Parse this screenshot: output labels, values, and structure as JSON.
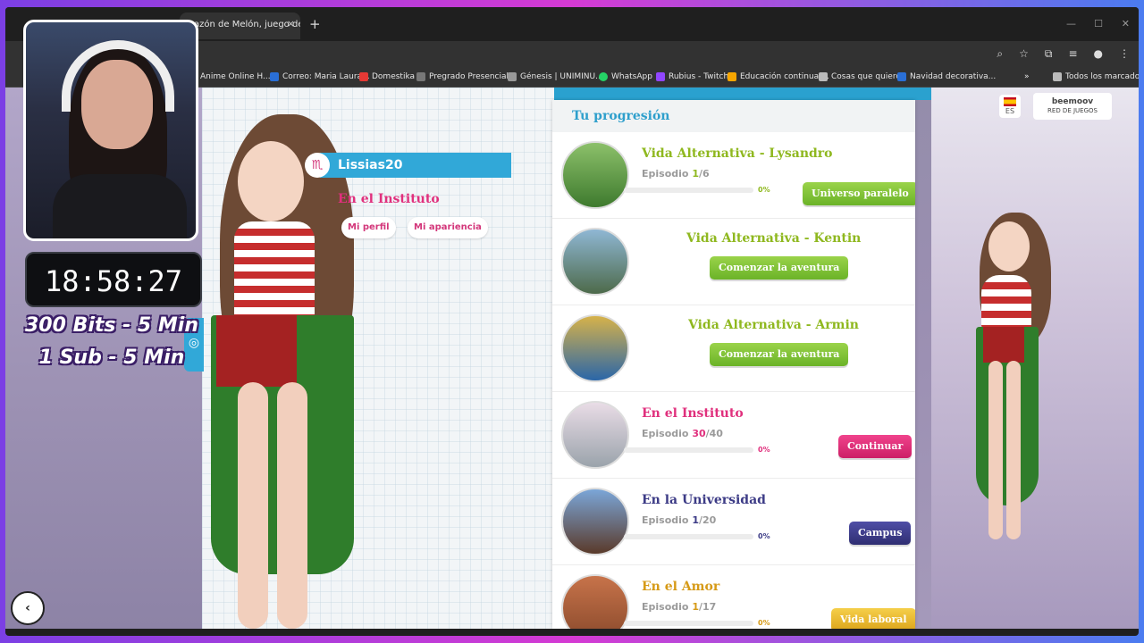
{
  "browser": {
    "tab_title": "azón de Melón, juego de ar",
    "tab_close": "×",
    "new_tab": "+",
    "bookmarks": [
      {
        "label": "Anime Online H...",
        "color": "#888888"
      },
      {
        "label": "Correo: Maria Laura...",
        "color": "#2a6fd6"
      },
      {
        "label": "Domestika",
        "color": "#e53935"
      },
      {
        "label": "Pregrado Presencial...",
        "color": "#777777"
      },
      {
        "label": "Génesis | UNIMINU...",
        "color": "#999999"
      },
      {
        "label": "WhatsApp",
        "color": "#25d366"
      },
      {
        "label": "Rubius - Twitch",
        "color": "#9146ff"
      },
      {
        "label": "Educación continua:...",
        "color": "#f7a600"
      },
      {
        "label": "Cosas que quiero",
        "color": "#bbbbbb"
      },
      {
        "label": "Navidad decorativa...",
        "color": "#2a6fd6"
      }
    ],
    "all_bookmarks": "Todos los marcadores"
  },
  "game": {
    "lang": "ES",
    "brand": "beemoov",
    "brand_sub": "RED DE JUEGOS",
    "profile": {
      "zodiac": "♏",
      "username": "Lissias20",
      "school": "En el Instituto",
      "buttons": [
        "Mi perfil",
        "Mi apariencia"
      ]
    },
    "progress_title": "Tu progresión",
    "entries": [
      {
        "title": "Vida Alternativa - Lysandro",
        "episode_label": "Episodio",
        "episode_current": "1",
        "episode_total": "/6",
        "progress": 0,
        "percent": "0%",
        "button": "Universo paralelo",
        "color": "#8fb81f"
      },
      {
        "title": "Vida Alternativa - Kentin",
        "button": "Comenzar la aventura",
        "color": "#8fb81f"
      },
      {
        "title": "Vida Alternativa - Armin",
        "button": "Comenzar la aventura",
        "color": "#8fb81f"
      },
      {
        "title": "En el Instituto",
        "episode_label": "Episodio",
        "episode_current": "30",
        "episode_total": "/40",
        "progress": 0,
        "percent": "0%",
        "button": "Continuar",
        "color": "#e0307d"
      },
      {
        "title": "En la Universidad",
        "episode_label": "Episodio",
        "episode_current": "1",
        "episode_total": "/20",
        "progress": 0,
        "percent": "0%",
        "button": "Campus",
        "color": "#3c3b86"
      },
      {
        "title": "En el Amor",
        "episode_label": "Episodio",
        "episode_current": "1",
        "episode_total": "/17",
        "progress": 0,
        "percent": "0%",
        "button": "Vida laboral",
        "color": "#d69a17"
      }
    ]
  },
  "overlay": {
    "timer": "18:58:27",
    "line1": "300 Bits - 5 Min",
    "line2": "1 Sub - 5 Min",
    "back": "‹"
  }
}
